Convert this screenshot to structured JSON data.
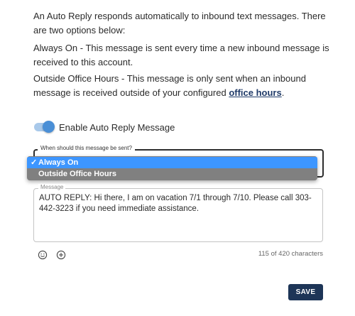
{
  "intro": {
    "paragraph1": "An Auto Reply responds automatically to inbound text messages. There are two options below:",
    "paragraph2": "Always On - This message is sent every time a new inbound message is received to this account.",
    "paragraph3_prefix": "Outside Office Hours - This message is only sent when an inbound message is received outside of your configured ",
    "paragraph3_link": "office hours",
    "paragraph3_suffix": "."
  },
  "toggle": {
    "label": "Enable Auto Reply Message",
    "enabled": true,
    "color": "#4a8fd6"
  },
  "send_when": {
    "legend": "When should this message be sent?",
    "selected": "Always On",
    "check_mark": "✓",
    "options": [
      "Always On",
      "Outside Office Hours"
    ],
    "highlight_color": "#3d96ff"
  },
  "message": {
    "legend": "Message",
    "text": "AUTO REPLY: Hi there, I am on vacation 7/1 through 7/10. Please call 303-442-3223 if you need immediate assistance.",
    "counter": "115 of 420 characters"
  },
  "icons": {
    "emoji": "smiley-icon",
    "add": "plus-circle-icon"
  },
  "actions": {
    "save_label": "SAVE",
    "save_color": "#1d3557"
  }
}
